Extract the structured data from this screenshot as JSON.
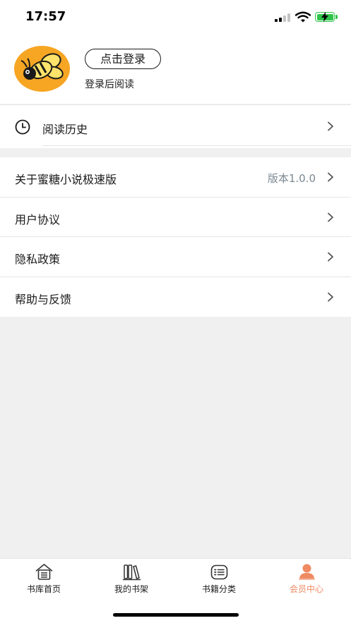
{
  "status_bar": {
    "time": "17:57",
    "icons": [
      "cellular-signal-icon",
      "wifi-icon",
      "battery-charging-icon"
    ],
    "battery_color": "#2ec44a"
  },
  "profile": {
    "avatar_icon": "bee-icon",
    "avatar_color": "#f6a623",
    "login_button_label": "点击登录",
    "login_hint": "登录后阅读"
  },
  "history": {
    "icon": "clock-icon",
    "label": "阅读历史"
  },
  "menu": {
    "items": [
      {
        "label": "关于蜜糖小说极速版",
        "value": "版本1.0.0"
      },
      {
        "label": "用户协议"
      },
      {
        "label": "隐私政策"
      },
      {
        "label": "帮助与反馈"
      }
    ]
  },
  "tabbar": {
    "active_color": "#f08a62",
    "tabs": [
      {
        "label": "书库首页",
        "icon": "home-icon"
      },
      {
        "label": "我的书架",
        "icon": "bookshelf-icon"
      },
      {
        "label": "书籍分类",
        "icon": "category-icon"
      },
      {
        "label": "会员中心",
        "icon": "user-icon",
        "active": true
      }
    ]
  }
}
